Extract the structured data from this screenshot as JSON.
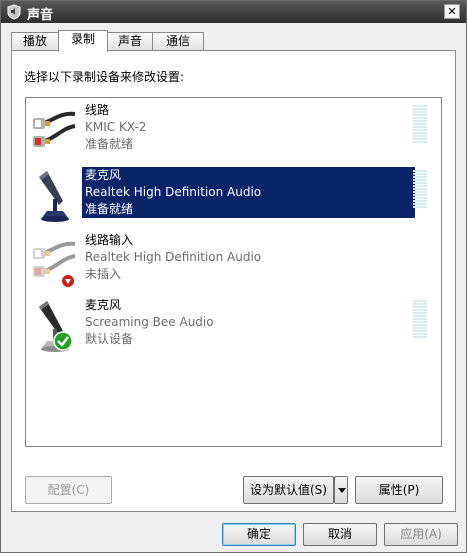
{
  "window": {
    "title": "声音"
  },
  "tabs": [
    {
      "label": "播放"
    },
    {
      "label": "录制"
    },
    {
      "label": "声音"
    },
    {
      "label": "通信"
    }
  ],
  "instruction": "选择以下录制设备来修改设置:",
  "devices": [
    {
      "name": "线路",
      "driver": "KMIC KX-2",
      "status": "准备就绪",
      "icon": "line-cable-icon"
    },
    {
      "name": "麦克风",
      "driver": "Realtek High Definition Audio",
      "status": "准备就绪",
      "icon": "microphone-icon"
    },
    {
      "name": "线路输入",
      "driver": "Realtek High Definition Audio",
      "status": "未插入",
      "icon": "line-in-cable-icon"
    },
    {
      "name": "麦克风",
      "driver": "Screaming Bee Audio",
      "status": "默认设备",
      "icon": "microphone-icon"
    }
  ],
  "buttons": {
    "configure": "配置(C)",
    "set_default": "设为默认值(S)",
    "properties": "属性(P)",
    "ok": "确定",
    "cancel": "取消",
    "apply": "应用(A)"
  }
}
